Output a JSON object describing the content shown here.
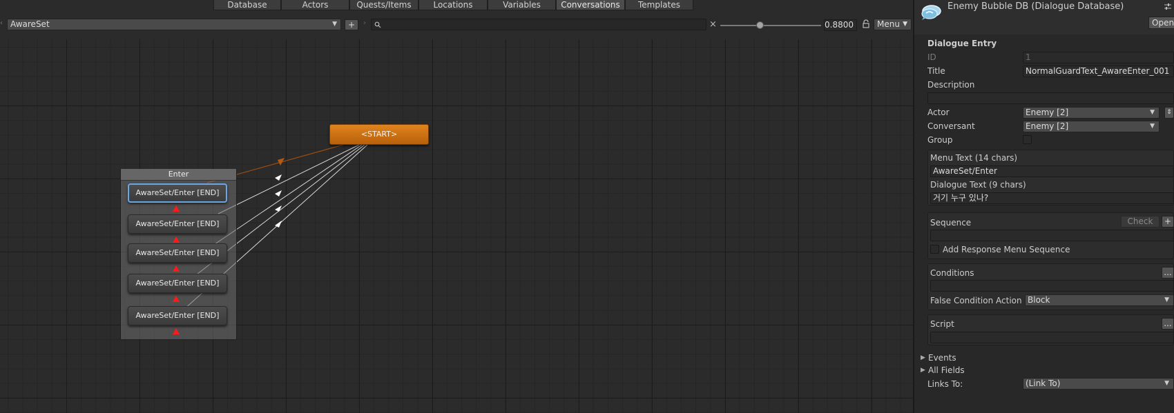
{
  "tabs": [
    "Database",
    "Actors",
    "Quests/Items",
    "Locations",
    "Variables",
    "Conversations",
    "Templates"
  ],
  "active_tab": "Conversations",
  "toolbar": {
    "conversation": "AwareSet",
    "add_label": "+",
    "zoom_value": "0.8800",
    "menu_label": "Menu",
    "clear_label": "×"
  },
  "canvas": {
    "start_label": "<START>",
    "group_title": "Enter",
    "entries": [
      "AwareSet/Enter [END]",
      "AwareSet/Enter [END]",
      "AwareSet/Enter [END]",
      "AwareSet/Enter [END]",
      "AwareSet/Enter [END]"
    ]
  },
  "inspector": {
    "db_title": "Enemy Bubble DB (Dialogue Database)",
    "open_label": "Open",
    "section_title": "Dialogue Entry",
    "id_label": "ID",
    "id_value": "1",
    "title_label": "Title",
    "title_value": "NormalGuardText_AwareEnter_001",
    "description_label": "Description",
    "description_value": "",
    "actor_label": "Actor",
    "actor_value": "Enemy [2]",
    "conversant_label": "Conversant",
    "conversant_value": "Enemy [2]",
    "group_label": "Group",
    "menu_text_label": "Menu Text (14 chars)",
    "menu_text_value": "AwareSet/Enter",
    "dialogue_text_label": "Dialogue Text (9 chars)",
    "dialogue_text_value": "거기 누구 있나?",
    "sequence_label": "Sequence",
    "check_label": "Check",
    "plus_label": "+",
    "add_response_label": "Add Response Menu Sequence",
    "conditions_label": "Conditions",
    "ellipsis_label": "...",
    "false_condition_label": "False Condition Action",
    "false_condition_value": "Block",
    "script_label": "Script",
    "events_label": "Events",
    "all_fields_label": "All Fields",
    "links_to_label": "Links To:",
    "links_to_value": "(Link To)"
  },
  "colors": {
    "start_node": "#d4761a",
    "selected_outline": "#6aa6e8",
    "arrow_red": "#ff1a1a"
  }
}
